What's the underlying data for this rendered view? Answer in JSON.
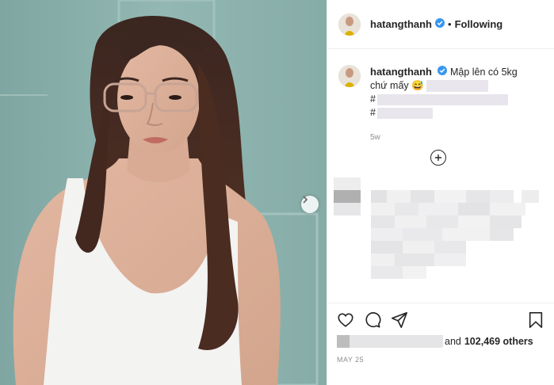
{
  "post": {
    "username": "hatangthanh",
    "follow_state": "Following",
    "separator": "•",
    "caption_text": "Mập lên có 5kg chứ mấy",
    "caption_emoji": "😅",
    "caption_hashtag_1": "#",
    "caption_hashtag_2": "#",
    "time_ago": "5w",
    "likes_suffix": "and",
    "likes_count": "102,469 others",
    "date": "MAY 25"
  },
  "colors": {
    "photo_background": "#8fb2ad",
    "verified_badge": "#3897f0",
    "text": "#262626",
    "muted": "#8e8e8e"
  },
  "icons": [
    "verified-badge-icon",
    "chevron-right-icon",
    "plus-circle-icon",
    "heart-icon",
    "comment-icon",
    "share-icon",
    "bookmark-icon"
  ]
}
